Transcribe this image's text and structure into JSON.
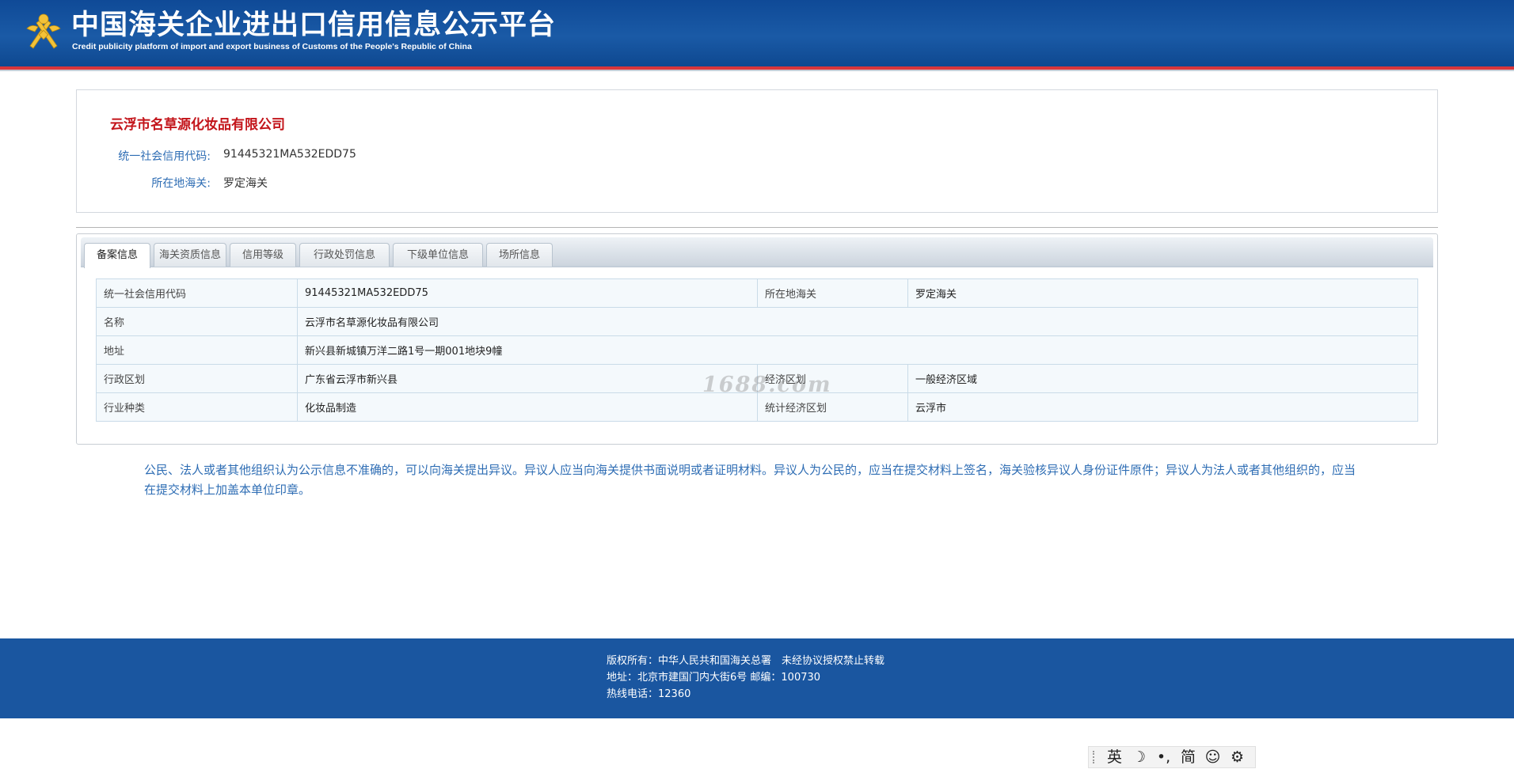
{
  "header": {
    "title_cn": "中国海关企业进出口信用信息公示平台",
    "title_en": "Credit publicity platform of import and export business of Customs of the People's Republic of China"
  },
  "summary": {
    "company_name": "云浮市名草源化妆品有限公司",
    "credit_code_label": "统一社会信用代码:",
    "credit_code": "91445321MA532EDD75",
    "customs_label": "所在地海关:",
    "customs": "罗定海关"
  },
  "tabs": [
    {
      "label": "备案信息",
      "active": true
    },
    {
      "label": "海关资质信息",
      "active": false
    },
    {
      "label": "信用等级",
      "active": false
    },
    {
      "label": "行政处罚信息",
      "active": false
    },
    {
      "label": "下级单位信息",
      "active": false
    },
    {
      "label": "场所信息",
      "active": false
    }
  ],
  "record": {
    "credit_code_label": "统一社会信用代码",
    "credit_code": "91445321MA532EDD75",
    "customs_label": "所在地海关",
    "customs": "罗定海关",
    "name_label": "名称",
    "name": "云浮市名草源化妆品有限公司",
    "address_label": "地址",
    "address": "新兴县新城镇万洋二路1号一期001地块9幢",
    "admin_region_label": "行政区划",
    "admin_region": "广东省云浮市新兴县",
    "econ_region_label": "经济区划",
    "econ_region": "一般经济区域",
    "industry_label": "行业种类",
    "industry": "化妆品制造",
    "stat_region_label": "统计经济区划",
    "stat_region": "云浮市"
  },
  "watermark": "1688.com",
  "notice": "公民、法人或者其他组织认为公示信息不准确的，可以向海关提出异议。异议人应当向海关提供书面说明或者证明材料。异议人为公民的，应当在提交材料上签名，海关验核异议人身份证件原件；异议人为法人或者其他组织的，应当在提交材料上加盖本单位印章。",
  "footer": {
    "copyright": "版权所有：中华人民共和国海关总署　未经协议授权禁止转载",
    "address": "地址：北京市建国门内大街6号 邮编：100730",
    "hotline": "热线电话：12360"
  },
  "ime": {
    "lang": "英",
    "moon": "☽",
    "punct": "•,",
    "script": "简",
    "emoji": "☺",
    "settings": "⚙"
  },
  "colors": {
    "header_blue": "#1a5aa6",
    "accent_red": "#c3141a",
    "link_blue": "#2e6db4",
    "footer_blue": "#1a56a0"
  }
}
